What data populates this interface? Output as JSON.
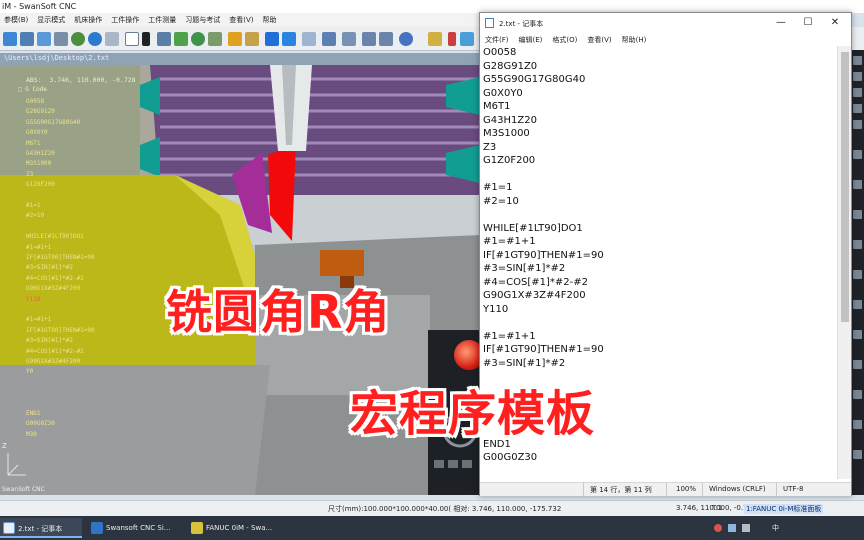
{
  "cnc": {
    "title": "iM - SwanSoft CNC",
    "menu": [
      "参模(B)",
      "显示模式",
      "机床操作",
      "工件操作",
      "工件测量",
      "习题与考试",
      "查看(V)",
      "帮助"
    ],
    "path": "\\Users\\lsdj\\Desktop\\2.txt",
    "abs_label": "ABS:",
    "abs_values": "3.746,  110.000,  -0.728",
    "gcode_title": "G Code",
    "gcode_lines": [
      "O0058",
      "G28G91Z0",
      "G55G90G17G80G40",
      "G0X0Y0",
      "M6T1",
      "G43H1Z20",
      "M3S1000",
      "Z3",
      "G1Z0F200",
      "",
      "#1=1",
      "#2=10",
      "",
      "WHILE[#1LT90]DO1",
      "#1=#1+1",
      "IF[#1GT90]THEN#1=90",
      "#3=SIN[#1]*#2",
      "#4=COS[#1]*#2-#2",
      "G90G1X#3Z#4F200",
      "Y110",
      "",
      "#1=#1+1",
      "IF[#1GT90]THEN#1=90",
      "#3=SIN[#1]*#2",
      "#4=COS[#1]*#2-#2",
      "G90G1X#3Z#4F200",
      "Y0",
      "",
      "",
      "",
      "END1",
      "G00G0Z30",
      "M30"
    ],
    "highlight_line_index": 19,
    "axis_label": "Z",
    "brand": "SwanSoft CNC",
    "status": {
      "coords": "尺寸(mm):100.000*100.000*40.00( 相对:  3.746,  110.000, -175.732",
      "coords2": "3.746,  110.000,  -0.728",
      "tool": "T:1",
      "machine": "1:FANUC 0i-M标准面板"
    }
  },
  "notepad": {
    "title": "2.txt - 记事本",
    "menu": [
      "文件(F)",
      "编辑(E)",
      "格式(O)",
      "查看(V)",
      "帮助(H)"
    ],
    "lines": [
      "O0058",
      "G28G91Z0",
      "G55G90G17G80G40",
      "G0X0Y0",
      "M6T1",
      "G43H1Z20",
      "M3S1000",
      "Z3",
      "G1Z0F200",
      "",
      "#1=1",
      "#2=10",
      "",
      "WHILE[#1LT90]DO1",
      "#1=#1+1",
      "IF[#1GT90]THEN#1=90",
      "#3=SIN[#1]*#2",
      "#4=COS[#1]*#2-#2",
      "G90G1X#3Z#4F200",
      "Y110",
      "",
      "#1=#1+1",
      "IF[#1GT90]THEN#1=90",
      "#3=SIN[#1]*#2",
      "",
      "",
      "",
      "",
      "",
      "END1",
      "G00G0Z30"
    ],
    "status": {
      "position": "第 14 行，第 11 列",
      "zoom": "100%",
      "line_ending": "Windows (CRLF)",
      "encoding": "UTF-8"
    }
  },
  "captions": {
    "line1": "铣圆角R角",
    "line2": "宏程序模板"
  },
  "taskbar": {
    "items": [
      "2.txt - 记事本",
      "Swansoft CNC Si...",
      "FANUC 0iM - Swa..."
    ],
    "tray_lang": "中"
  },
  "colors": {
    "caption_red": "#ff1f1f",
    "gcode_yellow": "#eae28a",
    "workpiece_yellow": "#c8c318",
    "fixture_purple": "#6e4f86",
    "teal": "#0f9d93",
    "taskbar_bg": "#2c3440"
  }
}
